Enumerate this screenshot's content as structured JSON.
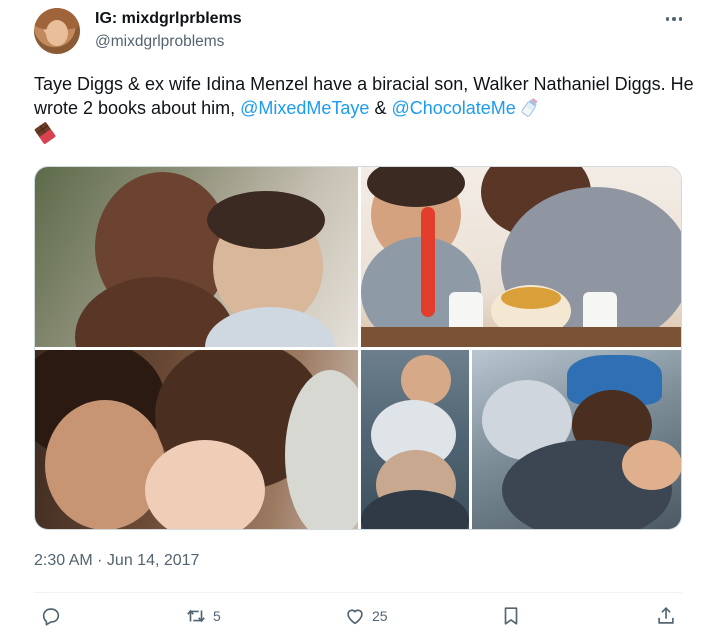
{
  "author": {
    "display_name": "IG: mixdgrlprblems",
    "handle": "@mixdgrlproblems"
  },
  "tweet": {
    "text_main": "Taye Diggs & ex wife Idina Menzel have a biracial son, Walker Nathaniel Diggs. He wrote 2 books about him, ",
    "mention_1": "@MixedMeTaye",
    "between": " & ",
    "mention_2": "@ChocolateMe",
    "emoji_1": "baby-bottle-icon",
    "emoji_2": "chocolate-bar-icon"
  },
  "media": {
    "photos": [
      "photo-man-with-toddler",
      "photo-child-and-man-eating",
      "photo-woman-man-baby",
      "photo-child-on-lap",
      "photo-man-carrying-child"
    ]
  },
  "timestamp": "2:30 AM · Jun 14, 2017",
  "actions": {
    "reply_count": "",
    "retweet_count": "5",
    "like_count": "25"
  },
  "colors": {
    "link": "#1d9bf0",
    "secondary_text": "#536471",
    "primary_text": "#0f1419"
  }
}
